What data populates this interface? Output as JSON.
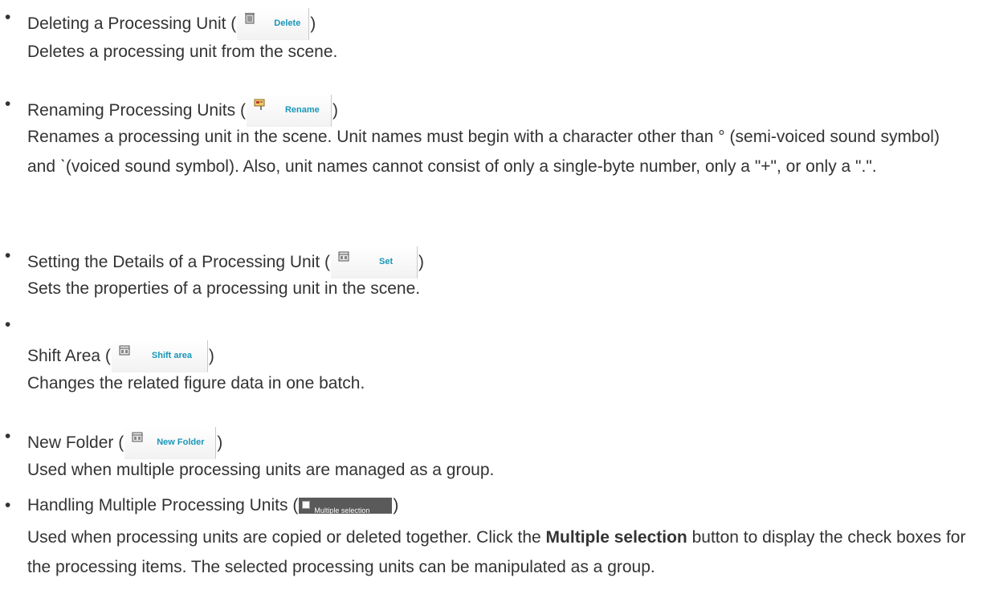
{
  "bullet_char": "•",
  "paren_open": " (",
  "paren_close": ")",
  "items": [
    {
      "title": "Deleting a Processing Unit",
      "button_label": "Delete",
      "button_icon": "trash-icon",
      "description": "Deletes a processing unit from the scene."
    },
    {
      "title": "Renaming Processing Units",
      "button_label": "Rename",
      "button_icon": "rename-icon",
      "description": "Renames a processing unit in the scene. Unit names must begin with a character other than ° (semi-voiced sound symbol) and ˋ(voiced sound symbol). Also, unit names cannot consist of only a single-byte number, only a \"+\", or only a \".\"."
    },
    {
      "title": "Setting the Details of a Processing Unit",
      "button_label": "Set",
      "button_icon": "settings-icon",
      "description": "Sets the properties of a processing unit in the scene."
    },
    {
      "title": "Shift Area",
      "button_label": "Shift area",
      "button_icon": "shift-area-icon",
      "description": "Changes the related figure data in one batch."
    },
    {
      "title": "New Folder",
      "button_label": "New Folder",
      "button_icon": "new-folder-icon",
      "description": "Used when multiple processing units are managed as a group."
    },
    {
      "title": "Handling Multiple Processing Units",
      "button_label": "Multiple selection",
      "button_icon": "checkbox-icon",
      "description_before": "Used when processing units are copied or deleted together. Click the ",
      "description_bold": "Multiple selection",
      "description_after": " button to display the check boxes for the processing items. The selected processing units can be manipulated as a group."
    }
  ]
}
